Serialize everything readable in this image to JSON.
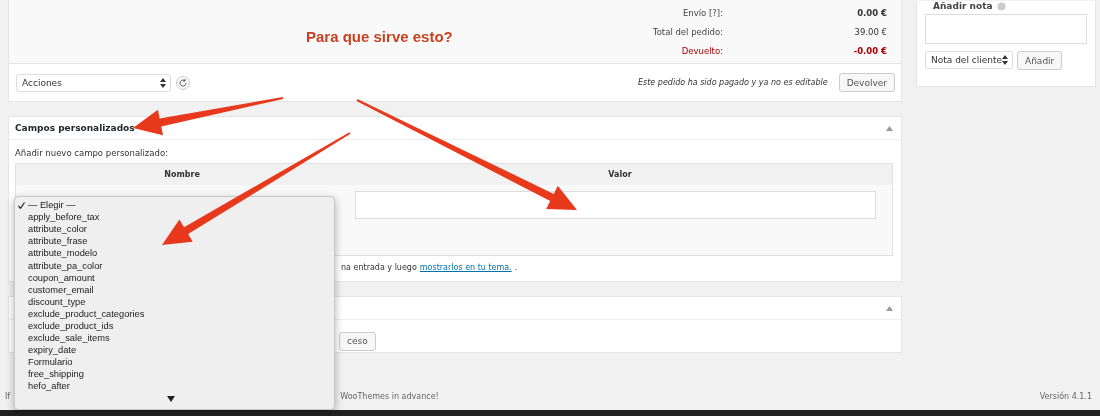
{
  "annotation": {
    "text": "Para que sirve esto?"
  },
  "totals": [
    {
      "kind": "plain",
      "label": "Envío [?]:",
      "value": "0.00 €",
      "bold": true
    },
    {
      "kind": "plain",
      "label": "Total del pedido:",
      "value": "39.00 €",
      "bold": false
    },
    {
      "kind": "refund",
      "label": "Devuelto:",
      "value": "-0.00 €",
      "bold": true
    }
  ],
  "actions": {
    "select": "Acciones",
    "notice": "Este pedido ha sido pagado y ya no es editable",
    "button": "Devolver"
  },
  "custom_fields": {
    "title": "Campos personalizados",
    "subtitle": "Añadir nuevo campo personalizado:",
    "columns": [
      "Nombre",
      "Valor"
    ],
    "hint": "na entrada y luego",
    "hint_link": "mostrarlos en tu tema.",
    "hint_end": "."
  },
  "dropdown": [
    {
      "label": "— Elegir —",
      "selected": true
    },
    {
      "label": "apply_before_tax",
      "selected": false
    },
    {
      "label": "attribute_color",
      "selected": false
    },
    {
      "label": "attribute_frase",
      "selected": false
    },
    {
      "label": "attribute_modelo",
      "selected": false
    },
    {
      "label": "attribute_pa_color",
      "selected": false
    },
    {
      "label": "coupon_amount",
      "selected": false
    },
    {
      "label": "customer_email",
      "selected": false
    },
    {
      "label": "discount_type",
      "selected": false
    },
    {
      "label": "exclude_product_categories",
      "selected": false
    },
    {
      "label": "exclude_product_ids",
      "selected": false
    },
    {
      "label": "exclude_sale_items",
      "selected": false
    },
    {
      "label": "expiry_date",
      "selected": false
    },
    {
      "label": "Formulario",
      "selected": false
    },
    {
      "label": "free_shipping",
      "selected": false
    },
    {
      "label": "hefo_after",
      "selected": false
    }
  ],
  "second_panel": {
    "button": "ceso"
  },
  "notes": {
    "title": "Añadir nota",
    "select": "Nota del cliente",
    "button": "Añadir"
  },
  "footer": {
    "left": "If",
    "middle": "WooThemes in advance!",
    "version": "Versión 4.1.1"
  }
}
